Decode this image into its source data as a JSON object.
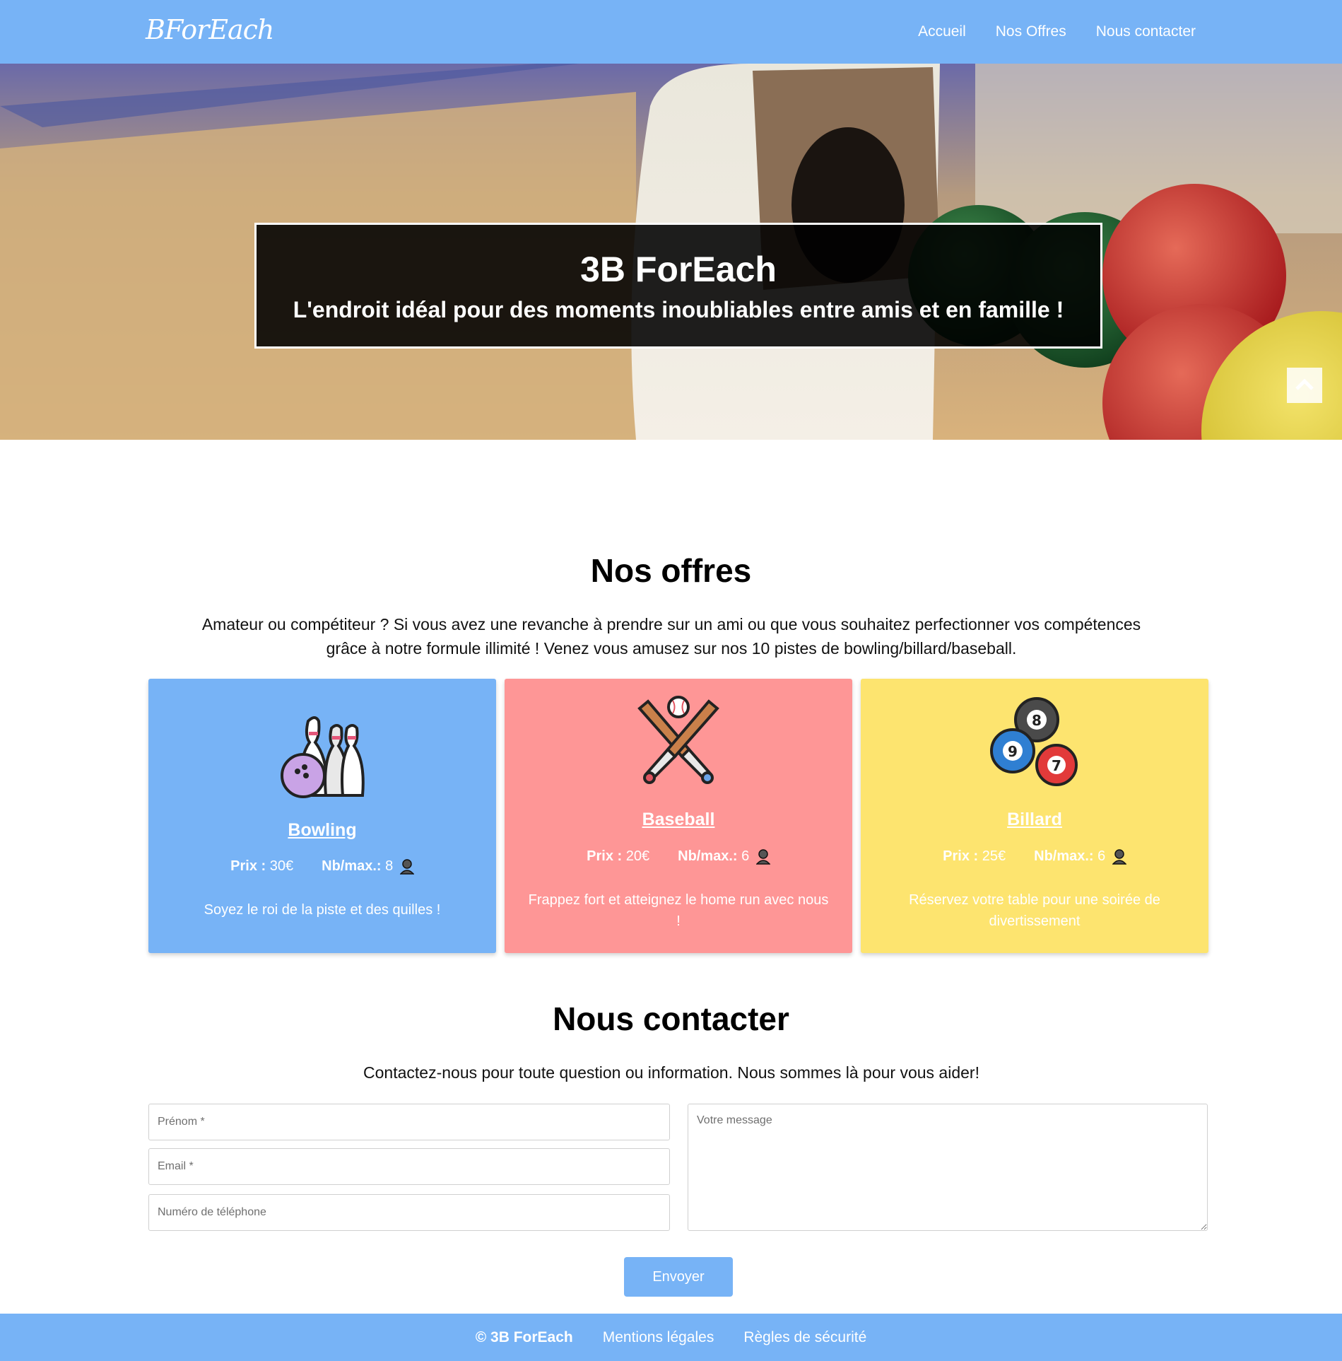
{
  "nav": {
    "logo": "BForEach",
    "links": [
      "Accueil",
      "Nos Offres",
      "Nous contacter"
    ]
  },
  "hero": {
    "title": "3B ForEach",
    "subtitle": "L'endroit idéal pour des moments inoubliables entre amis et en famille !"
  },
  "offers": {
    "title": "Nos offres",
    "description": "Amateur ou compétiteur ? Si vous avez une revanche à prendre sur un ami ou que vous souhaitez perfectionner vos compétences grâce à notre formule illimité ! Venez vous amusez sur nos 10 pistes de bowling/billard/baseball.",
    "price_label": "Prix :",
    "max_label": "Nb/max.:",
    "cards": [
      {
        "name": "Bowling",
        "price": "30€",
        "max": "8",
        "text": "Soyez le roi de la piste et des quilles !",
        "icon": "bowling-icon",
        "color": "#77b3f6"
      },
      {
        "name": "Baseball",
        "price": "20€",
        "max": "6",
        "text": "Frappez fort et atteignez le home run avec nous !",
        "icon": "baseball-icon",
        "color": "#fe9696"
      },
      {
        "name": "Billard",
        "price": "25€",
        "max": "6",
        "text": "Réservez votre table pour une soirée de divertissement",
        "icon": "billiard-icon",
        "color": "#fde46f"
      }
    ]
  },
  "contact": {
    "title": "Nous contacter",
    "description": "Contactez-nous pour toute question ou information. Nous sommes là pour vous aider!",
    "firstname_placeholder": "Prénom *",
    "email_placeholder": "Email *",
    "phone_placeholder": "Numéro de téléphone",
    "message_placeholder": "Votre message",
    "submit_label": "Envoyer"
  },
  "footer": {
    "copyright": "© 3B ForEach",
    "legal": "Mentions légales",
    "safety": "Règles de sécurité"
  },
  "colors": {
    "primary": "#77b3f6",
    "baseball": "#fe9696",
    "billiard": "#fde46f"
  }
}
